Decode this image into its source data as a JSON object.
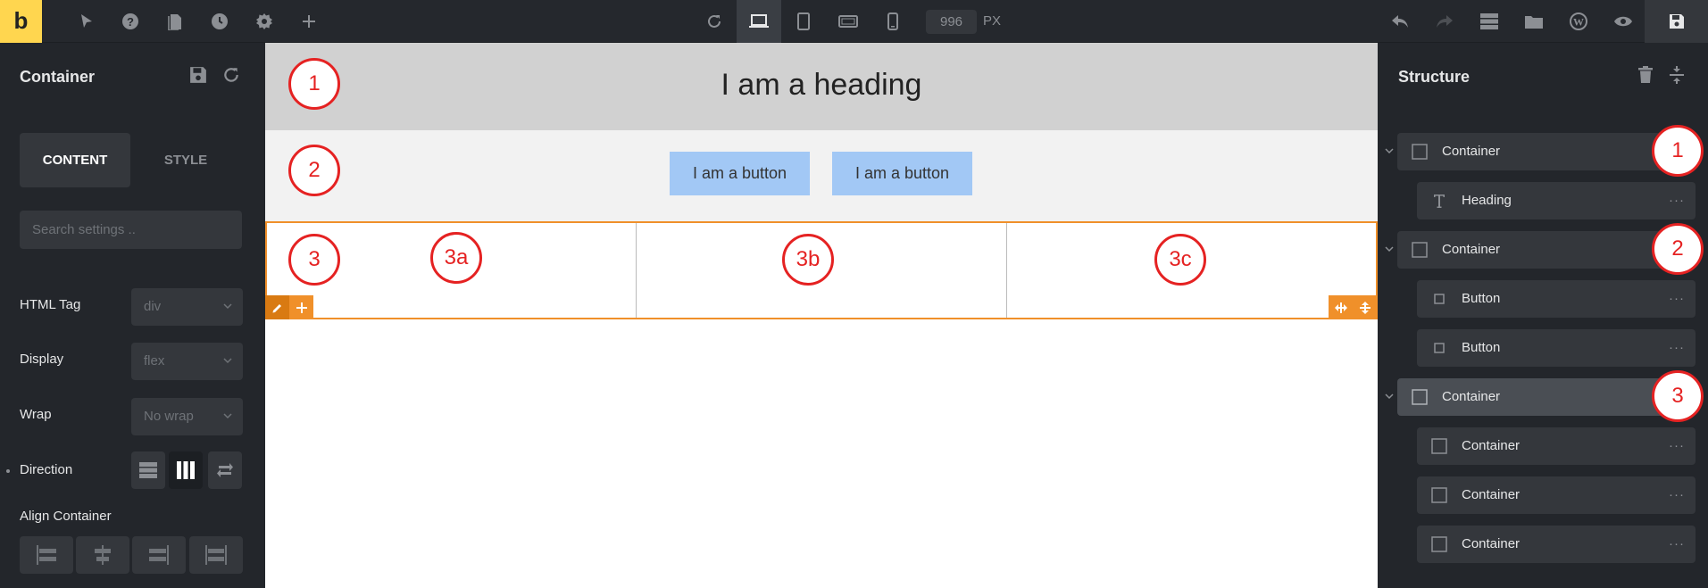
{
  "topbar": {
    "logo": "b",
    "width_value": "996",
    "width_unit": "PX"
  },
  "left_panel": {
    "title": "Container",
    "tabs": [
      "CONTENT",
      "STYLE"
    ],
    "search_placeholder": "Search settings ..",
    "controls": [
      {
        "label": "HTML Tag",
        "value": "div"
      },
      {
        "label": "Display",
        "value": "flex"
      },
      {
        "label": "Wrap",
        "value": "No wrap"
      }
    ],
    "direction_label": "Direction",
    "align_label": "Align Container"
  },
  "canvas": {
    "heading": "I am a heading",
    "buttons": [
      "I am a button",
      "I am a button"
    ],
    "callouts": [
      "1",
      "2",
      "3",
      "3a",
      "3b",
      "3c"
    ]
  },
  "structure": {
    "title": "Structure",
    "items": [
      {
        "label": "Container",
        "icon": "container-icon",
        "level": 0
      },
      {
        "label": "Heading",
        "icon": "heading-icon",
        "level": 1
      },
      {
        "label": "Container",
        "icon": "container-icon",
        "level": 0
      },
      {
        "label": "Button",
        "icon": "button-icon",
        "level": 1
      },
      {
        "label": "Button",
        "icon": "button-icon",
        "level": 1
      },
      {
        "label": "Container",
        "icon": "container-icon",
        "level": 0,
        "active": true
      },
      {
        "label": "Container",
        "icon": "container-icon",
        "level": 1
      },
      {
        "label": "Container",
        "icon": "container-icon",
        "level": 1
      },
      {
        "label": "Container",
        "icon": "container-icon",
        "level": 1
      }
    ],
    "callouts": [
      "1",
      "2",
      "3"
    ],
    "more_glyph": "···"
  },
  "colors": {
    "accent_orange": "#f0902a",
    "logo_yellow": "#ffd64f",
    "callout_red": "#e52222",
    "button_blue": "#a2c8f5"
  }
}
